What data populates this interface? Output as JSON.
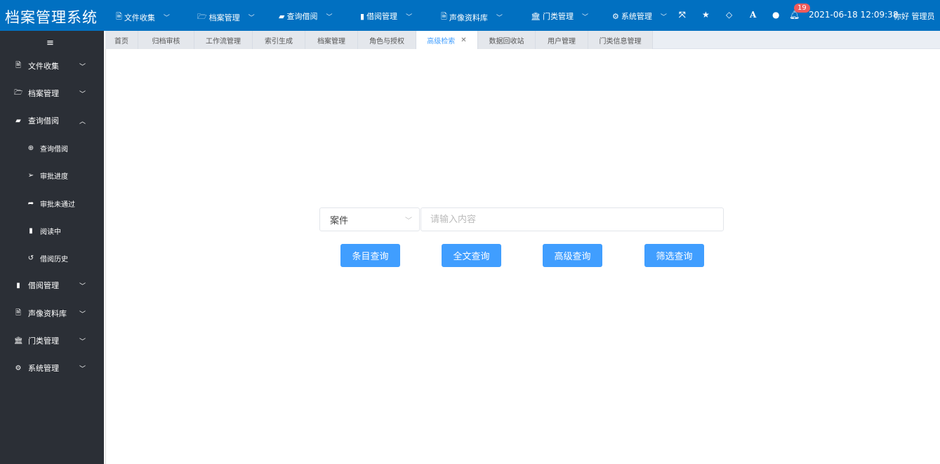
{
  "header": {
    "logo": "档案管理系统",
    "nav": [
      {
        "label": "文件收集",
        "icon": "pdf-file-icon"
      },
      {
        "label": "档案管理",
        "icon": "folder-open-icon"
      },
      {
        "label": "查询借阅",
        "icon": "book-icon"
      },
      {
        "label": "借阅管理",
        "icon": "bookmark-icon"
      },
      {
        "label": "声像资料库",
        "icon": "media-file-icon"
      },
      {
        "label": "门类管理",
        "icon": "bank-icon"
      },
      {
        "label": "系统管理",
        "icon": "cogs-icon"
      }
    ],
    "notification_count": "19",
    "datetime": "2021-06-18 12:09:38",
    "user": "你好 管理员"
  },
  "sidebar": {
    "items": [
      {
        "label": "文件收集",
        "icon": "pdf-file-icon"
      },
      {
        "label": "档案管理",
        "icon": "folder-open-icon"
      },
      {
        "label": "查询借阅",
        "icon": "book-icon",
        "expanded": true
      },
      {
        "label": "查询借阅",
        "icon": "search-plus-icon"
      },
      {
        "label": "审批进度",
        "icon": "paper-plane-icon"
      },
      {
        "label": "审批未通过",
        "icon": "share-icon"
      },
      {
        "label": "阅读中",
        "icon": "bookmark-icon"
      },
      {
        "label": "借阅历史",
        "icon": "history-icon"
      },
      {
        "label": "借阅管理",
        "icon": "bookmark-icon"
      },
      {
        "label": "声像资料库",
        "icon": "media-file-icon"
      },
      {
        "label": "门类管理",
        "icon": "bank-icon"
      },
      {
        "label": "系统管理",
        "icon": "cogs-icon"
      }
    ]
  },
  "tabs": [
    "首页",
    "归档审核",
    "工作流管理",
    "索引生成",
    "档案管理",
    "角色与授权",
    "高级检索",
    "数据回收站",
    "用户管理",
    "门类信息管理"
  ],
  "active_tab": "高级检索",
  "search": {
    "select_value": "案件",
    "placeholder": "请输入内容",
    "buttons": [
      "条目查询",
      "全文查询",
      "高级查询",
      "筛选查询"
    ]
  },
  "colors": {
    "header": "#0170c1",
    "sidebar": "#2b2f36",
    "primary": "#409eff"
  }
}
